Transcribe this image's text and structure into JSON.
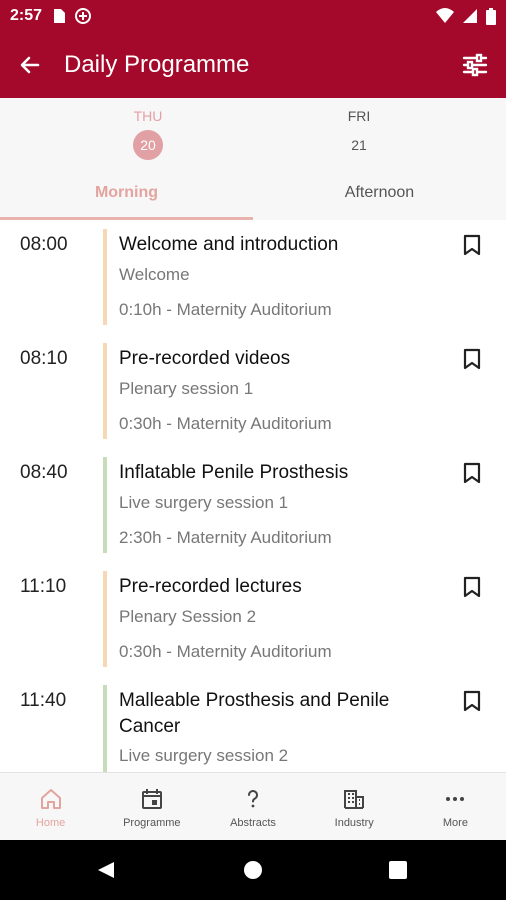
{
  "status": {
    "time": "2:57"
  },
  "appbar": {
    "title": "Daily Programme"
  },
  "days": [
    {
      "name": "THU",
      "num": "20"
    },
    {
      "name": "FRI",
      "num": "21"
    }
  ],
  "tabs": [
    "Morning",
    "Afternoon"
  ],
  "items": [
    {
      "time": "08:00",
      "title": "Welcome and introduction",
      "session": "Welcome",
      "meta": "0:10h - Maternity Auditorium",
      "color": "#f6d9b4"
    },
    {
      "time": "08:10",
      "title": "Pre-recorded videos",
      "session": "Plenary session 1",
      "meta": "0:30h - Maternity Auditorium",
      "color": "#f6d9b4"
    },
    {
      "time": "08:40",
      "title": "Inflatable Penile Prosthesis",
      "session": "Live surgery session 1",
      "meta": "2:30h - Maternity Auditorium",
      "color": "#c7ddb9"
    },
    {
      "time": "11:10",
      "title": "Pre-recorded lectures",
      "session": "Plenary Session 2",
      "meta": "0:30h - Maternity Auditorium",
      "color": "#f6d9b4"
    },
    {
      "time": "11:40",
      "title": "Malleable Prosthesis and Penile Cancer",
      "session": "Live surgery session 2",
      "meta": "",
      "color": "#c7ddb9"
    }
  ],
  "nav": [
    {
      "label": "Home"
    },
    {
      "label": "Programme"
    },
    {
      "label": "Abstracts"
    },
    {
      "label": "Industry"
    },
    {
      "label": "More"
    }
  ]
}
